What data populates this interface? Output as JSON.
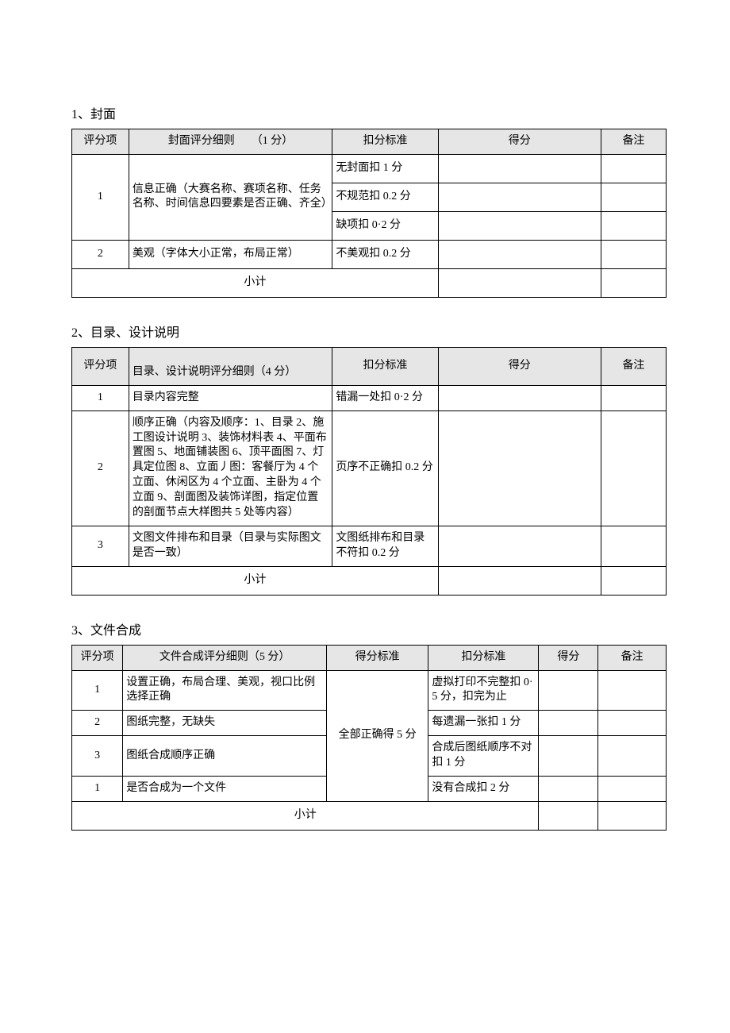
{
  "sections": [
    {
      "title": "1、封面",
      "headers": [
        "评分项",
        "封面评分细则　　（1 分）",
        "扣分标准",
        "得分",
        "备注"
      ],
      "cols": [
        70,
        250,
        130,
        200,
        80
      ],
      "rows": [
        {
          "idx": "1",
          "rowspan": 3,
          "detail": "信息正确（大赛名称、赛项名称、任务名称、时间信息四要素是否正确、齐全）",
          "detail_rowspan": 3,
          "std": "无封面扣 1 分"
        },
        {
          "std": "不规范扣 0.2 分"
        },
        {
          "std": "缺项扣 0·2 分"
        },
        {
          "idx": "2",
          "detail": "美观（字体大小正常，布局正常）",
          "std": "不美观扣 0.2 分"
        }
      ],
      "subtotal": "小计",
      "subtotal_span": 3
    },
    {
      "title": "2、目录、设计说明",
      "headers": [
        "评分项",
        "目录、设计说明评分细则（4 分）",
        "扣分标准",
        "得分",
        "备注"
      ],
      "cols": [
        70,
        250,
        130,
        200,
        80
      ],
      "rows": [
        {
          "idx": "1",
          "detail": "目录内容完整",
          "std": "错漏一处扣 0·2 分"
        },
        {
          "idx": "2",
          "detail": "顺序正确（内容及顺序：1、目录 2、施工图设计说明 3、装饰材料表 4、平面布置图 5、地面铺装图 6、顶平面图 7、灯具定位图 8、立面丿图：客餐厅为 4 个立面、休闲区为 4 个立面、主卧为 4 个立面 9、剖面图及装饰详图，指定位置的剖面节点大样图共 5 处等内容）",
          "std": "页序不正确扣 0.2 分"
        },
        {
          "idx": "3",
          "detail": "文图文件排布和目录（目录与实际图文是否一致）",
          "std": "文图纸排布和目录不符扣 0.2 分"
        }
      ],
      "subtotal": "小计",
      "subtotal_span": 3
    },
    {
      "title": "3、文件合成",
      "headers": [
        "评分项",
        "文件合成评分细则（5 分）",
        "得分标准",
        "扣分标准",
        "得分",
        "备注"
      ],
      "cols": [
        60,
        250,
        120,
        130,
        70,
        80
      ],
      "rows": [
        {
          "idx": "1",
          "detail": "设置正确，布局合理、美观，视口比例选择正确",
          "scorestd": "全部正确得 5 分",
          "scorestd_rowspan": 4,
          "std": "虚拟打印不完整扣 0·5 分，扣完为止"
        },
        {
          "idx": "2",
          "detail": "图纸完整，无缺失",
          "std": "每遗漏一张扣 1 分"
        },
        {
          "idx": "3",
          "detail": "图纸合成顺序正确",
          "std": "合成后图纸顺序不对扣 1 分"
        },
        {
          "idx": "1",
          "detail": "是否合成为一个文件",
          "std": "没有合成扣 2 分"
        }
      ],
      "subtotal": "小计",
      "subtotal_span": 4
    }
  ]
}
